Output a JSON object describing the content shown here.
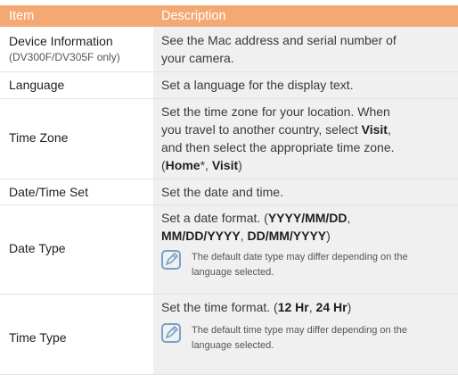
{
  "colors": {
    "header_bg": "#f4a974",
    "header_text": "#ffffff",
    "desc_bg": "#f0f0f0",
    "note_icon": "#7a9fc8"
  },
  "header": {
    "item": "Item",
    "description": "Description"
  },
  "rows": [
    {
      "item": "Device Information",
      "item_sub": "(DV300F/DV305F only)",
      "desc": [
        "See the Mac address and serial number of",
        "your camera."
      ]
    },
    {
      "item": "Language",
      "desc": [
        "Set a language for the display text."
      ]
    },
    {
      "item": "Time Zone",
      "desc": [
        "Set the time zone for your location. When",
        "you travel to another country, select ",
        "Visit",
        ",",
        "and then select the appropriate time zone.",
        "(",
        "Home",
        "*, ",
        "Visit",
        ")"
      ]
    },
    {
      "item": "Date/Time Set",
      "desc": [
        "Set the date and time."
      ]
    },
    {
      "item": "Date Type",
      "desc": [
        "Set a date format. (",
        "YYYY/MM/DD",
        ",",
        "MM/DD/YYYY",
        ", ",
        "DD/MM/YYYY",
        ")"
      ],
      "note": [
        "The default date type may differ depending on the",
        "language selected."
      ]
    },
    {
      "item": "Time Type",
      "desc": [
        "Set the time format. (",
        "12 Hr",
        ", ",
        "24 Hr",
        ")"
      ],
      "note": [
        "The default time type may differ depending on the",
        "language selected."
      ]
    }
  ]
}
